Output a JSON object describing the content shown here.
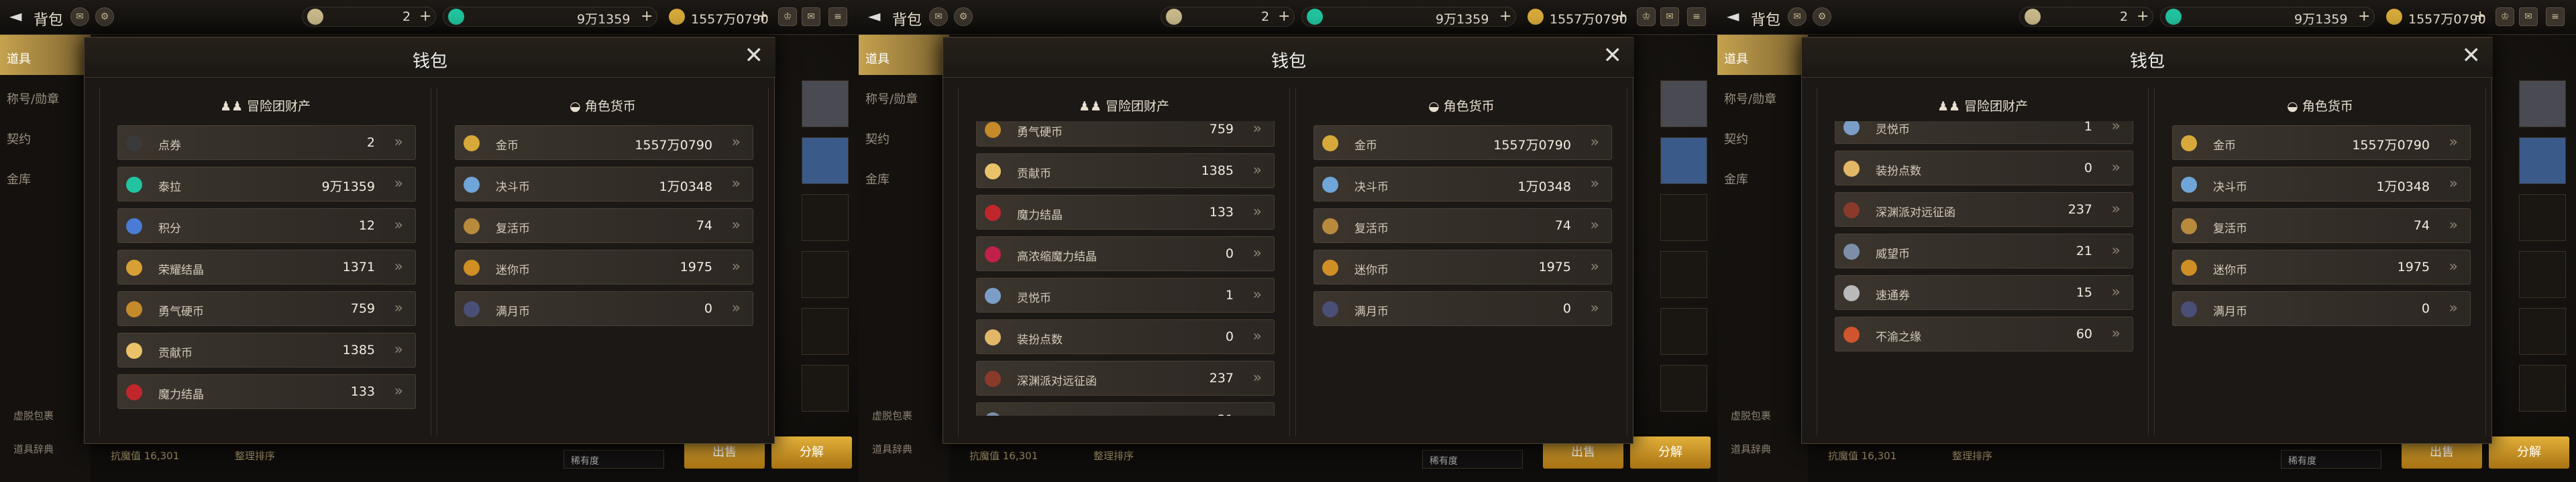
{
  "window": {
    "bag_title": "背包",
    "back_icon": "back-arrow-icon"
  },
  "topbar": {
    "coupon_count": "2",
    "coupon_plus": "+",
    "tera": "9万1359",
    "tera_plus": "+",
    "gold": "1557万0790",
    "gold_plus": "+"
  },
  "leftnav": {
    "items": [
      "道具",
      "称号/勋章",
      "契约",
      "金库"
    ],
    "bottom": [
      "虚脱包裹",
      "道具辞典"
    ]
  },
  "bottombar": {
    "text1": "抗魔值 16,301",
    "text2": "整理排序",
    "select": "稀有度",
    "btn_sell": "出售",
    "btn_decompose": "分解"
  },
  "dialog": {
    "title": "钱包",
    "close": "✕"
  },
  "sections": {
    "adventure": "冒险团财产",
    "character": "角色货币"
  },
  "adventure_items": [
    {
      "name": "点券",
      "value": "2",
      "icon_color": "#3a3a3a",
      "glyph": "C"
    },
    {
      "name": "泰拉",
      "value": "9万1359",
      "icon_color": "#21c4a0",
      "glyph": ""
    },
    {
      "name": "积分",
      "value": "12",
      "icon_color": "#4a7bd6",
      "glyph": "卌"
    },
    {
      "name": "荣耀结晶",
      "value": "1371",
      "icon_color": "#d7a034",
      "glyph": ""
    },
    {
      "name": "勇气硬币",
      "value": "759",
      "icon_color": "#c58a2a",
      "glyph": ""
    },
    {
      "name": "贡献币",
      "value": "1385",
      "icon_color": "#e9c26a",
      "glyph": ""
    },
    {
      "name": "魔力结晶",
      "value": "133",
      "icon_color": "#c1262d",
      "glyph": ""
    },
    {
      "name": "高浓缩魔力结晶",
      "value": "0",
      "icon_color": "#c0204a",
      "glyph": ""
    },
    {
      "name": "灵悦币",
      "value": "1",
      "icon_color": "#7a9ec8",
      "glyph": ""
    },
    {
      "name": "装扮点数",
      "value": "0",
      "icon_color": "#e2b768",
      "glyph": ""
    },
    {
      "name": "深渊派对远征函",
      "value": "237",
      "icon_color": "#8a3a2a",
      "glyph": ""
    },
    {
      "name": "威望币",
      "value": "21",
      "icon_color": "#7d8ea8",
      "glyph": ""
    },
    {
      "name": "速通券",
      "value": "15",
      "icon_color": "#b9b9b9",
      "glyph": ""
    },
    {
      "name": "不渝之缘",
      "value": "60",
      "icon_color": "#d0542d",
      "glyph": ""
    }
  ],
  "character_items": [
    {
      "name": "金币",
      "value": "1557万0790",
      "icon_color": "#d6a93a"
    },
    {
      "name": "决斗币",
      "value": "1万0348",
      "icon_color": "#6fa5d8"
    },
    {
      "name": "复活币",
      "value": "74",
      "icon_color": "#b88a3c"
    },
    {
      "name": "迷你币",
      "value": "1975",
      "icon_color": "#cf8f24"
    },
    {
      "name": "满月币",
      "value": "0",
      "icon_color": "#4a4f78"
    }
  ],
  "panels_scroll_start": [
    0,
    4,
    8
  ]
}
